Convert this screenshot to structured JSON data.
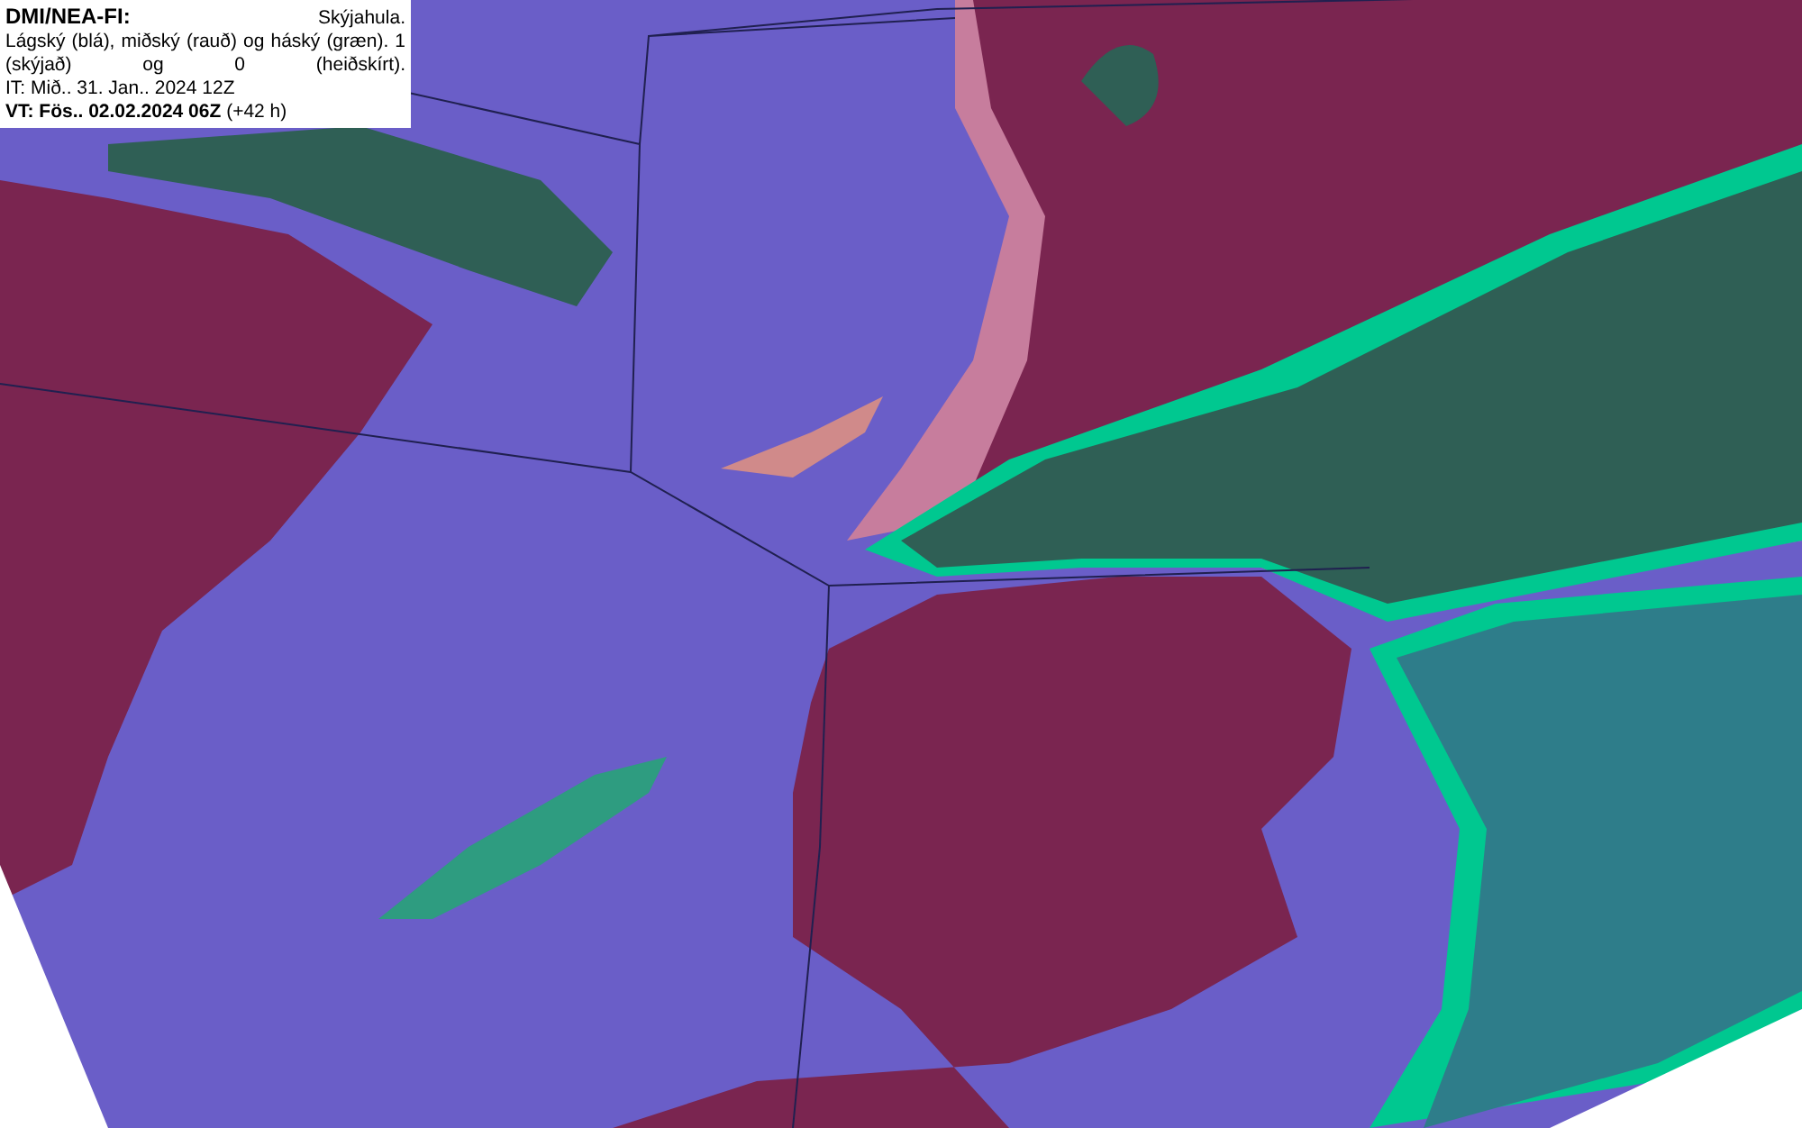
{
  "legend": {
    "source": "DMI/NEA-FI:",
    "field": "Skýjahula.",
    "description": "Lágský (blá), miðský (rauð) og háský (græn). 1 (skýjað) og 0 (heiðskírt).",
    "initial_time": "IT: Mið.. 31. Jan.. 2024 12Z",
    "valid_time": "**VT: Fös.. 02.02.2024 06Z** (+42 h)"
  }
}
